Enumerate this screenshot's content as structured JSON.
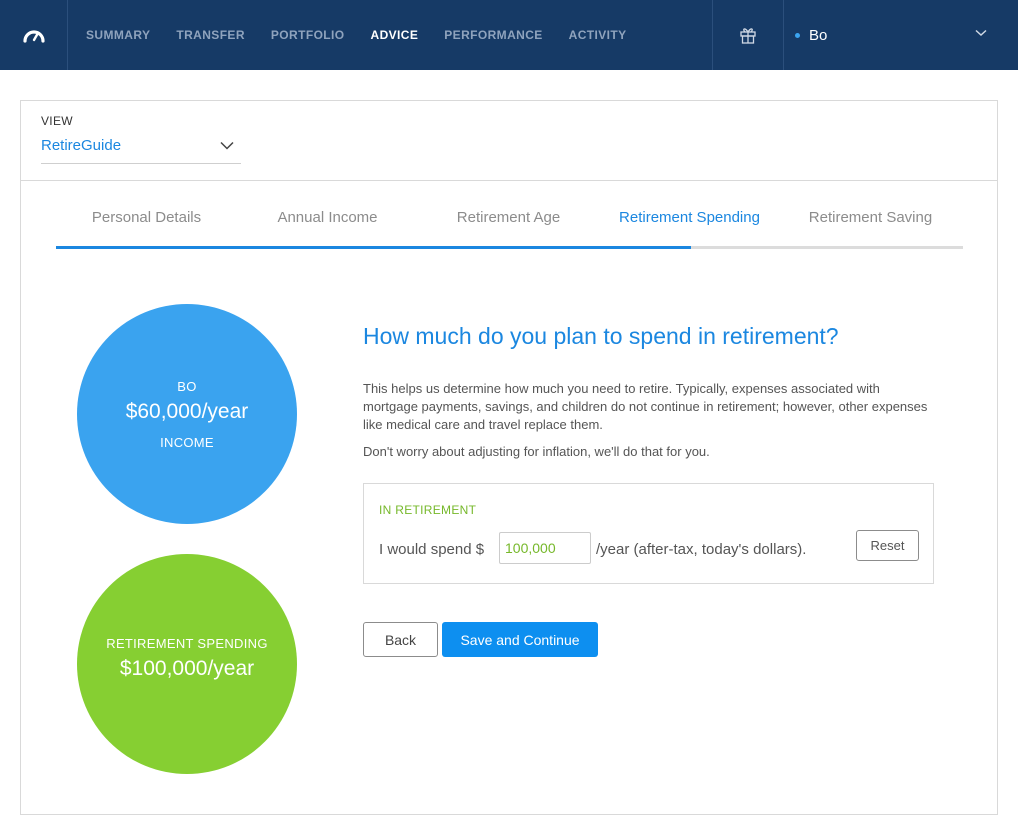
{
  "nav": {
    "logo_icon": "speedometer-logo-icon",
    "items": [
      {
        "label": "SUMMARY",
        "active": false
      },
      {
        "label": "TRANSFER",
        "active": false
      },
      {
        "label": "PORTFOLIO",
        "active": false
      },
      {
        "label": "ADVICE",
        "active": true
      },
      {
        "label": "PERFORMANCE",
        "active": false
      },
      {
        "label": "ACTIVITY",
        "active": false
      }
    ],
    "gift_icon": "gift-icon",
    "user_name": "Bo",
    "user_menu_icon": "chevron-down-icon"
  },
  "view": {
    "label": "VIEW",
    "selected": "RetireGuide"
  },
  "steps": [
    {
      "label": "Personal Details",
      "active": false
    },
    {
      "label": "Annual Income",
      "active": false
    },
    {
      "label": "Retirement Age",
      "active": false
    },
    {
      "label": "Retirement Spending",
      "active": true
    },
    {
      "label": "Retirement Saving",
      "active": false
    }
  ],
  "progress_fraction": 0.7,
  "income_circle": {
    "name": "BO",
    "amount": "$60,000/year",
    "caption": "INCOME",
    "color": "#3aa3ef"
  },
  "spending_circle": {
    "caption": "RETIREMENT SPENDING",
    "amount": "$100,000/year",
    "color": "#86cf32"
  },
  "question": {
    "title": "How much do you plan to spend in retirement?",
    "description": "This helps us determine how much you need to retire. Typically, expenses associated with mortgage payments, savings, and children do not continue in retirement; however, other expenses like medical care and travel replace them.",
    "note": "Don't worry about adjusting for inflation, we'll do that for you."
  },
  "spend_box": {
    "label": "IN RETIREMENT",
    "prefix": "I would spend $",
    "value": "100,000",
    "suffix": "/year (after-tax, today's dollars).",
    "reset_label": "Reset"
  },
  "buttons": {
    "back_label": "Back",
    "save_label": "Save and Continue"
  },
  "colors": {
    "nav_bg": "#163a66",
    "accent": "#1b87e0",
    "primary_button": "#0d8ff0",
    "green": "#76b82a"
  }
}
